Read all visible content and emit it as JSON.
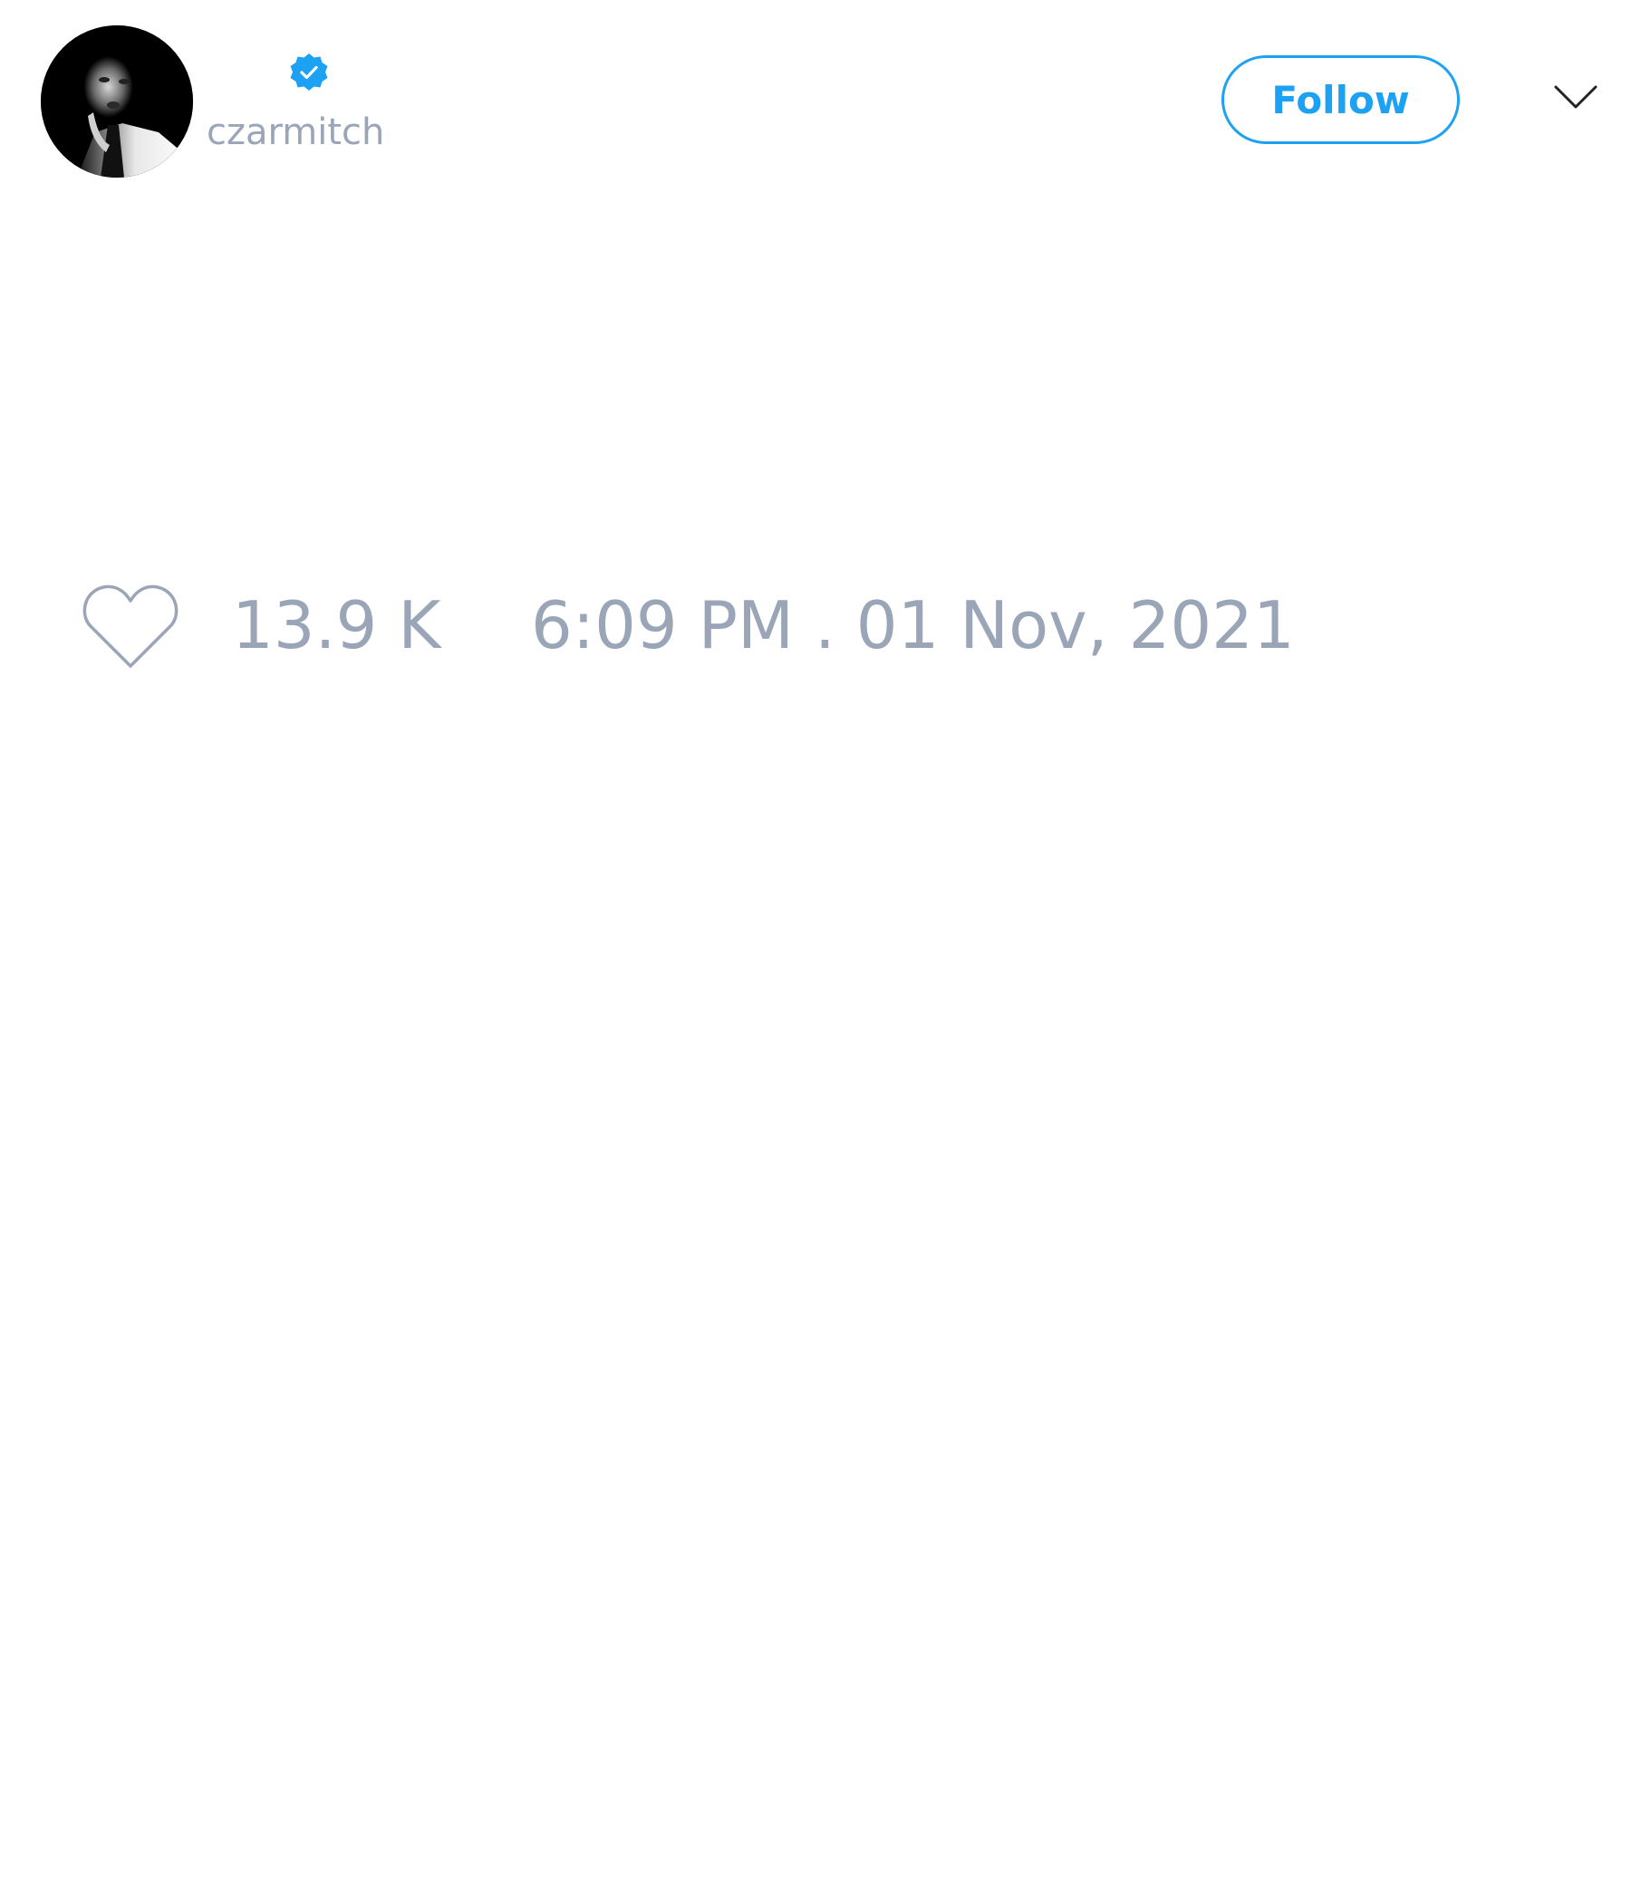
{
  "tweet": {
    "author": {
      "handle": "czarmitch",
      "verified": true,
      "avatar_icon": "profile-photo"
    },
    "follow_label": "Follow",
    "menu_icon": "chevron-down-icon",
    "like_icon": "heart-outline-icon",
    "like_count": "13.9 K",
    "timestamp": "6:09 PM . 01 Nov, 2021"
  },
  "colors": {
    "accent": "#1da1f2",
    "muted_text": "#9aa6b8",
    "background": "#ffffff"
  }
}
